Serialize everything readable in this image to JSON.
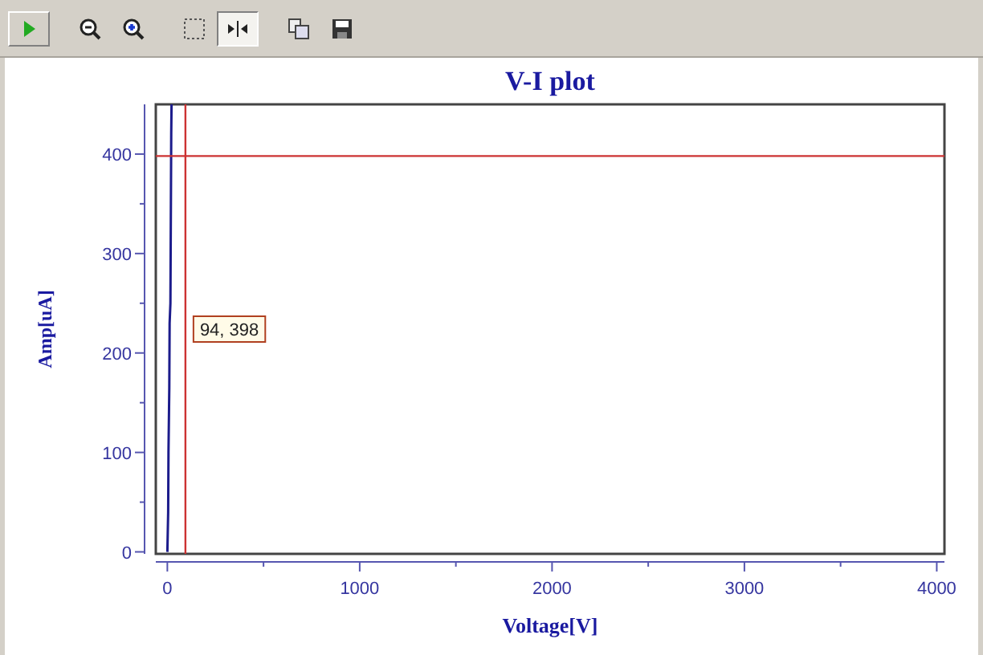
{
  "toolbar": {
    "groups": [
      [
        {
          "kind": "run",
          "pressed": false
        }
      ],
      [
        {
          "kind": "zoom-out",
          "pressed": false
        },
        {
          "kind": "zoom-in",
          "pressed": false
        }
      ],
      [
        {
          "kind": "select",
          "pressed": false
        },
        {
          "kind": "fit",
          "pressed": true
        }
      ],
      [
        {
          "kind": "copy",
          "pressed": false
        },
        {
          "kind": "save",
          "pressed": false
        }
      ]
    ]
  },
  "plot": {
    "chart_data": {
      "type": "line",
      "title": "V-I plot",
      "xlabel": "Voltage[V]",
      "ylabel": "Amp[uA]",
      "x": [
        0,
        4,
        6,
        10,
        12,
        16,
        20,
        22
      ],
      "series": [
        {
          "color": "#1c1c8c",
          "values": [
            0,
            40,
            100,
            165,
            230,
            250,
            420,
            450
          ]
        }
      ],
      "xlim": [
        -60,
        4040
      ],
      "ylim": [
        -2,
        450
      ],
      "xticks": [
        0,
        1000,
        2000,
        3000,
        4000
      ],
      "yticks": [
        0,
        100,
        200,
        300,
        400
      ],
      "ref_lines": [
        {
          "axis": "x",
          "value": 94,
          "color": "#cc3333"
        },
        {
          "axis": "y",
          "value": 398,
          "color": "#cc3333"
        }
      ],
      "annotations": [
        "94, 398"
      ]
    }
  }
}
